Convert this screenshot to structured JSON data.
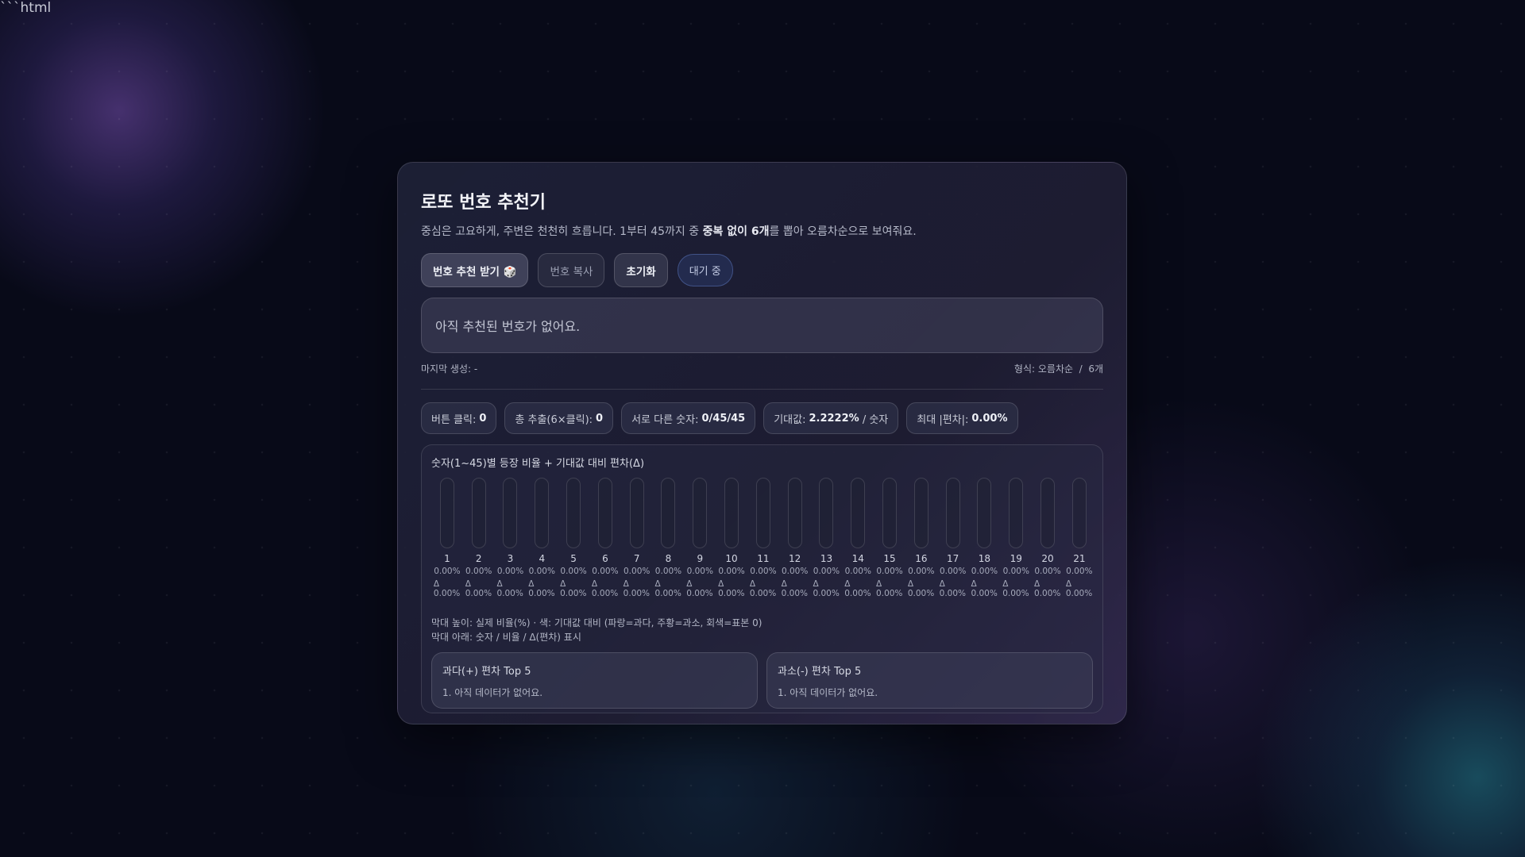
{
  "stray_text": "```html",
  "header": {
    "title": "로또 번호 추천기",
    "subtitle_pre": "중심은 고요하게, 주변은 천천히 흐릅니다. 1부터 45까지 중 ",
    "subtitle_bold1": "중복 없이 6개",
    "subtitle_post": "를 뽑아 오름차순으로 보여줘요."
  },
  "buttons": {
    "generate": "번호 추천 받기 🎲",
    "copy": "번호 복사",
    "reset": "초기화",
    "status": "대기 중"
  },
  "result": {
    "empty": "아직 추천된 번호가 없어요."
  },
  "meta": {
    "last": "마지막 생성: -",
    "format": "형식: 오름차순  /  6개"
  },
  "stats": [
    {
      "label": "버튼 클릭:",
      "value": "0"
    },
    {
      "label": "총 추출(6×클릭):",
      "value": "0"
    },
    {
      "label": "서로 다른 숫자:",
      "value": "0/45/45"
    },
    {
      "label": "기대값:",
      "value": "2.2222%",
      "suffix": " / 숫자"
    },
    {
      "label": "최대 |편차|:",
      "value": "0.00%"
    }
  ],
  "chart_data": {
    "type": "bar",
    "title": "숫자(1~45)별 등장 비율 + 기대값 대비 편차(Δ)",
    "categories": [
      "1",
      "2",
      "3",
      "4",
      "5",
      "6",
      "7",
      "8",
      "9",
      "10",
      "11",
      "12",
      "13",
      "14",
      "15",
      "16",
      "17",
      "18",
      "19",
      "20",
      "21"
    ],
    "values": [
      0,
      0,
      0,
      0,
      0,
      0,
      0,
      0,
      0,
      0,
      0,
      0,
      0,
      0,
      0,
      0,
      0,
      0,
      0,
      0,
      0
    ],
    "ratio_labels": [
      "0.00%",
      "0.00%",
      "0.00%",
      "0.00%",
      "0.00%",
      "0.00%",
      "0.00%",
      "0.00%",
      "0.00%",
      "0.00%",
      "0.00%",
      "0.00%",
      "0.00%",
      "0.00%",
      "0.00%",
      "0.00%",
      "0.00%",
      "0.00%",
      "0.00%",
      "0.00%",
      "0.00%"
    ],
    "delta_labels": [
      "Δ 0.00%",
      "Δ 0.00%",
      "Δ 0.00%",
      "Δ 0.00%",
      "Δ 0.00%",
      "Δ 0.00%",
      "Δ 0.00%",
      "Δ 0.00%",
      "Δ 0.00%",
      "Δ 0.00%",
      "Δ 0.00%",
      "Δ 0.00%",
      "Δ 0.00%",
      "Δ 0.00%",
      "Δ 0.00%",
      "Δ 0.00%",
      "Δ 0.00%",
      "Δ 0.00%",
      "Δ 0.00%",
      "Δ 0.00%",
      "Δ 0.00%"
    ],
    "ylim": [
      0,
      100
    ],
    "colors": {
      "over": "#4a8cff",
      "under": "#ff9a3c",
      "zero": "#808494"
    }
  },
  "legend": {
    "line1": "막대 높이: 실제 비율(%) · 색: 기대값 대비 (파랑=과다, 주황=과소, 회색=표본 0)",
    "line2": "막대 아래: 숫자 / 비율 / Δ(편차) 표시"
  },
  "top5": {
    "over": {
      "title": "과다(+) 편차 Top 5",
      "items": [
        "1. 아직 데이터가 없어요."
      ]
    },
    "under": {
      "title": "과소(-) 편차 Top 5",
      "items": [
        "1. 아직 데이터가 없어요."
      ]
    }
  }
}
